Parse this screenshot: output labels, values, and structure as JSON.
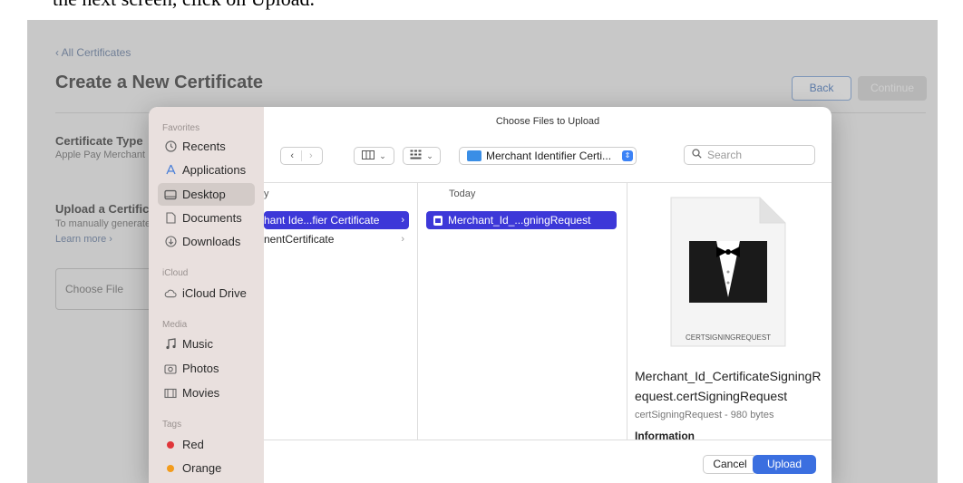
{
  "top_text": "the next screen, click on Upload.",
  "page": {
    "breadcrumb": "‹ All Certificates",
    "title": "Create a New Certificate",
    "back_label": "Back",
    "continue_label": "Continue",
    "cert_type_title": "Certificate Type",
    "cert_type_value": "Apple Pay Merchant Identity Certificate",
    "upload_title": "Upload a Certificate Signing Request",
    "upload_desc": "To manually generate a Certificate, you need a Certificate Signing Request (CSR) file from your Mac.",
    "learn_more": "Learn more ›",
    "choose_file": "Choose File"
  },
  "dialog": {
    "title": "Choose Files to Upload",
    "view_columns_icon": "columns-icon",
    "location": "Merchant Identifier Certi...",
    "search_placeholder": "Search",
    "sidebar": {
      "favorites_heading": "Favorites",
      "favorites": [
        {
          "label": "Recents",
          "icon": "clock-icon"
        },
        {
          "label": "Applications",
          "icon": "applications-icon"
        },
        {
          "label": "Desktop",
          "icon": "desktop-icon",
          "selected": true
        },
        {
          "label": "Documents",
          "icon": "document-icon"
        },
        {
          "label": "Downloads",
          "icon": "download-icon"
        }
      ],
      "icloud_heading": "iCloud",
      "icloud": [
        {
          "label": "iCloud Drive",
          "icon": "cloud-icon"
        }
      ],
      "media_heading": "Media",
      "media": [
        {
          "label": "Music",
          "icon": "music-icon"
        },
        {
          "label": "Photos",
          "icon": "photos-icon"
        },
        {
          "label": "Movies",
          "icon": "movies-icon"
        }
      ],
      "tags_heading": "Tags",
      "tags": [
        {
          "label": "Red",
          "color": "#e0363a"
        },
        {
          "label": "Orange",
          "color": "#f39c1c"
        }
      ]
    },
    "column1": {
      "header": "y",
      "rows": [
        "hant Ide...fier Certificate",
        "nentCertificate"
      ]
    },
    "column2": {
      "header": "Today",
      "rows": [
        "Merchant_Id_...gningRequest"
      ]
    },
    "preview": {
      "icon_label": "CERTSIGNINGREQUEST",
      "filename": "Merchant_Id_CertificateSigningRequest.certSigningRequest",
      "meta": "certSigningRequest - 980 bytes",
      "info_heading": "Information"
    },
    "cancel_label": "Cancel",
    "upload_label": "Upload"
  }
}
